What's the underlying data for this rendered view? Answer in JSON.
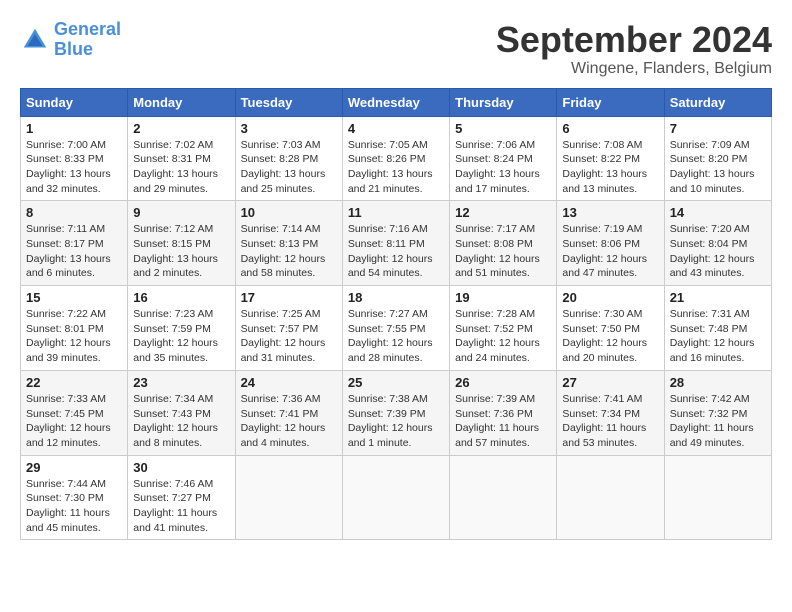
{
  "header": {
    "logo_line1": "General",
    "logo_line2": "Blue",
    "title": "September 2024",
    "subtitle": "Wingene, Flanders, Belgium"
  },
  "days_of_week": [
    "Sunday",
    "Monday",
    "Tuesday",
    "Wednesday",
    "Thursday",
    "Friday",
    "Saturday"
  ],
  "weeks": [
    [
      {
        "num": "1",
        "rise": "7:00 AM",
        "set": "8:33 PM",
        "daylight": "13 hours and 32 minutes."
      },
      {
        "num": "2",
        "rise": "7:02 AM",
        "set": "8:31 PM",
        "daylight": "13 hours and 29 minutes."
      },
      {
        "num": "3",
        "rise": "7:03 AM",
        "set": "8:28 PM",
        "daylight": "13 hours and 25 minutes."
      },
      {
        "num": "4",
        "rise": "7:05 AM",
        "set": "8:26 PM",
        "daylight": "13 hours and 21 minutes."
      },
      {
        "num": "5",
        "rise": "7:06 AM",
        "set": "8:24 PM",
        "daylight": "13 hours and 17 minutes."
      },
      {
        "num": "6",
        "rise": "7:08 AM",
        "set": "8:22 PM",
        "daylight": "13 hours and 13 minutes."
      },
      {
        "num": "7",
        "rise": "7:09 AM",
        "set": "8:20 PM",
        "daylight": "13 hours and 10 minutes."
      }
    ],
    [
      {
        "num": "8",
        "rise": "7:11 AM",
        "set": "8:17 PM",
        "daylight": "13 hours and 6 minutes."
      },
      {
        "num": "9",
        "rise": "7:12 AM",
        "set": "8:15 PM",
        "daylight": "13 hours and 2 minutes."
      },
      {
        "num": "10",
        "rise": "7:14 AM",
        "set": "8:13 PM",
        "daylight": "12 hours and 58 minutes."
      },
      {
        "num": "11",
        "rise": "7:16 AM",
        "set": "8:11 PM",
        "daylight": "12 hours and 54 minutes."
      },
      {
        "num": "12",
        "rise": "7:17 AM",
        "set": "8:08 PM",
        "daylight": "12 hours and 51 minutes."
      },
      {
        "num": "13",
        "rise": "7:19 AM",
        "set": "8:06 PM",
        "daylight": "12 hours and 47 minutes."
      },
      {
        "num": "14",
        "rise": "7:20 AM",
        "set": "8:04 PM",
        "daylight": "12 hours and 43 minutes."
      }
    ],
    [
      {
        "num": "15",
        "rise": "7:22 AM",
        "set": "8:01 PM",
        "daylight": "12 hours and 39 minutes."
      },
      {
        "num": "16",
        "rise": "7:23 AM",
        "set": "7:59 PM",
        "daylight": "12 hours and 35 minutes."
      },
      {
        "num": "17",
        "rise": "7:25 AM",
        "set": "7:57 PM",
        "daylight": "12 hours and 31 minutes."
      },
      {
        "num": "18",
        "rise": "7:27 AM",
        "set": "7:55 PM",
        "daylight": "12 hours and 28 minutes."
      },
      {
        "num": "19",
        "rise": "7:28 AM",
        "set": "7:52 PM",
        "daylight": "12 hours and 24 minutes."
      },
      {
        "num": "20",
        "rise": "7:30 AM",
        "set": "7:50 PM",
        "daylight": "12 hours and 20 minutes."
      },
      {
        "num": "21",
        "rise": "7:31 AM",
        "set": "7:48 PM",
        "daylight": "12 hours and 16 minutes."
      }
    ],
    [
      {
        "num": "22",
        "rise": "7:33 AM",
        "set": "7:45 PM",
        "daylight": "12 hours and 12 minutes."
      },
      {
        "num": "23",
        "rise": "7:34 AM",
        "set": "7:43 PM",
        "daylight": "12 hours and 8 minutes."
      },
      {
        "num": "24",
        "rise": "7:36 AM",
        "set": "7:41 PM",
        "daylight": "12 hours and 4 minutes."
      },
      {
        "num": "25",
        "rise": "7:38 AM",
        "set": "7:39 PM",
        "daylight": "12 hours and 1 minute."
      },
      {
        "num": "26",
        "rise": "7:39 AM",
        "set": "7:36 PM",
        "daylight": "11 hours and 57 minutes."
      },
      {
        "num": "27",
        "rise": "7:41 AM",
        "set": "7:34 PM",
        "daylight": "11 hours and 53 minutes."
      },
      {
        "num": "28",
        "rise": "7:42 AM",
        "set": "7:32 PM",
        "daylight": "11 hours and 49 minutes."
      }
    ],
    [
      {
        "num": "29",
        "rise": "7:44 AM",
        "set": "7:30 PM",
        "daylight": "11 hours and 45 minutes."
      },
      {
        "num": "30",
        "rise": "7:46 AM",
        "set": "7:27 PM",
        "daylight": "11 hours and 41 minutes."
      },
      null,
      null,
      null,
      null,
      null
    ]
  ]
}
